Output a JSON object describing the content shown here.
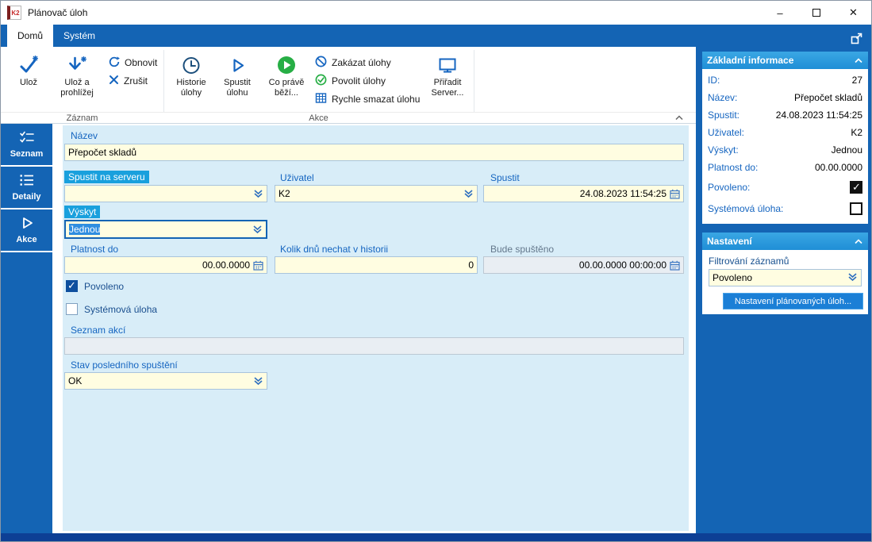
{
  "window": {
    "title": "Plánovač úloh",
    "app_icon_text": "K2",
    "controls": {
      "minimize": "–",
      "close": "✕"
    }
  },
  "tabs": {
    "home": "Domů",
    "system": "Systém"
  },
  "ribbon": {
    "save": "Ulož",
    "save_and_view": "Ulož a prohlížej",
    "refresh": "Obnovit",
    "cancel": "Zrušit",
    "task_history": "Historie úlohy",
    "run_task": "Spustit úlohu",
    "running_now": "Co právě běží...",
    "disable_tasks": "Zakázat úlohy",
    "enable_tasks": "Povolit úlohy",
    "quick_delete": "Rychle smazat úlohu",
    "assign_server": "Přiřadit Server...",
    "group_record": "Záznam",
    "group_actions": "Akce"
  },
  "sidebar": {
    "items": [
      {
        "label": "Seznam"
      },
      {
        "label": "Detaily"
      },
      {
        "label": "Akce"
      }
    ]
  },
  "form": {
    "nazev": {
      "label": "Název",
      "value": "Přepočet skladů"
    },
    "spustit_na_serveru": {
      "label": "Spustit na serveru",
      "value": ""
    },
    "uzivatel": {
      "label": "Uživatel",
      "value": "K2"
    },
    "spustit": {
      "label": "Spustit",
      "value": "24.08.2023 11:54:25"
    },
    "vyskyt": {
      "label": "Výskyt",
      "value": "Jednou"
    },
    "platnost_do": {
      "label": "Platnost do",
      "value": "00.00.0000"
    },
    "kolik_dnu": {
      "label": "Kolik dnů nechat v historii",
      "value": "0"
    },
    "bude_spusteno": {
      "label": "Bude spuštěno",
      "value": "00.00.0000 00:00:00"
    },
    "povoleno": {
      "label": "Povoleno",
      "checked": true
    },
    "systemova_uloha": {
      "label": "Systémová úloha",
      "checked": false
    },
    "seznam_akci": {
      "label": "Seznam akcí",
      "value": ""
    },
    "stav_posledniho_spusteni": {
      "label": "Stav posledního spuštění",
      "value": "OK"
    }
  },
  "panel": {
    "basic_info": {
      "title": "Základní informace",
      "rows": [
        {
          "label": "ID:",
          "value": "27"
        },
        {
          "label": "Název:",
          "value": "Přepočet skladů"
        },
        {
          "label": "Spustit:",
          "value": "24.08.2023 11:54:25"
        },
        {
          "label": "Uživatel:",
          "value": "K2"
        },
        {
          "label": "Výskyt:",
          "value": "Jednou"
        },
        {
          "label": "Platnost do:",
          "value": "00.00.0000"
        }
      ],
      "povoleno": {
        "label": "Povoleno:",
        "checked": true
      },
      "systemova_uloha": {
        "label": "Systémová úloha:",
        "checked": false
      }
    },
    "settings": {
      "title": "Nastavení",
      "filter_label": "Filtrování záznamů",
      "filter_value": "Povoleno",
      "button_label": "Nastavení plánovaných úloh..."
    }
  },
  "colors": {
    "accent": "#1565c0",
    "panel_blue": "#1464b4",
    "section_header": "#2398dd",
    "field_bg": "#fffde1",
    "field_disabled": "#e9eef3",
    "form_bg": "#d8edf8",
    "label_highlight": "#19a0dd",
    "footer": "#0d3f95",
    "green": "#27ae45"
  }
}
